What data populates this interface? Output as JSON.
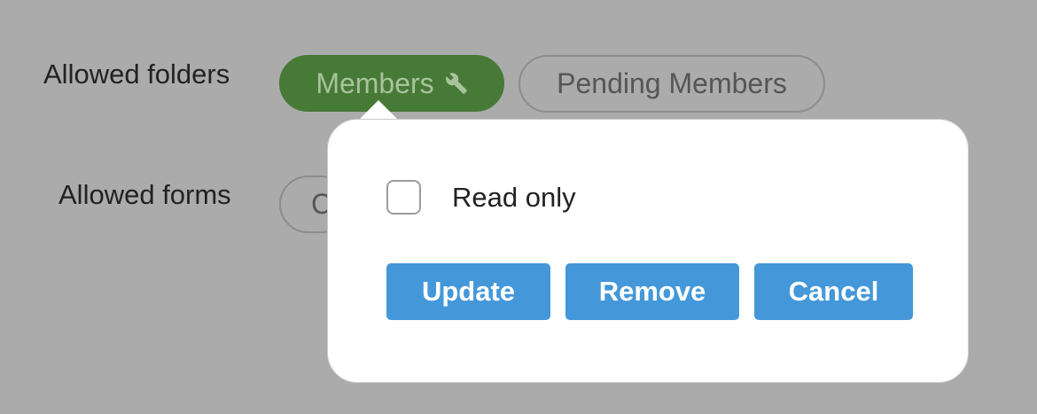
{
  "form": {
    "folders_label": "Allowed folders",
    "forms_label": "Allowed forms"
  },
  "folders": {
    "members_chip": "Members",
    "members_icon": "wrench-icon",
    "pending_chip": "Pending Members"
  },
  "forms": {
    "chip_partial": "C"
  },
  "popover": {
    "read_only_label": "Read only",
    "read_only_checked": false,
    "update_label": "Update",
    "remove_label": "Remove",
    "cancel_label": "Cancel"
  },
  "colors": {
    "background": "#ababab",
    "chip_selected_bg": "#477a36",
    "button_bg": "#4498d9"
  }
}
